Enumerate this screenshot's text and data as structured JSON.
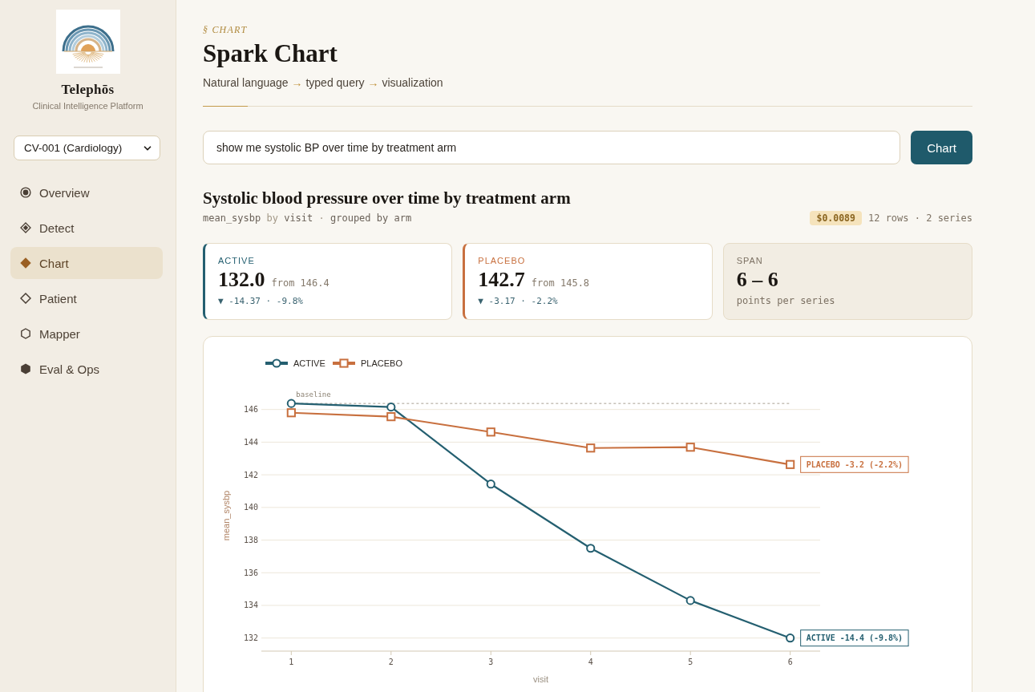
{
  "sidebar": {
    "brand": {
      "name": "Telephōs",
      "tagline": "Clinical Intelligence Platform"
    },
    "study_select": {
      "value": "CV-001 (Cardiology)"
    },
    "nav": [
      {
        "label": "Overview",
        "selected": false
      },
      {
        "label": "Detect",
        "selected": false
      },
      {
        "label": "Chart",
        "selected": true
      },
      {
        "label": "Patient",
        "selected": false
      },
      {
        "label": "Mapper",
        "selected": false
      },
      {
        "label": "Eval & Ops",
        "selected": false
      }
    ]
  },
  "header": {
    "eyebrow": "§ CHART",
    "title": "Spark Chart",
    "subtitle": [
      {
        "kind": "text",
        "text": "Natural language"
      },
      {
        "kind": "arrow",
        "text": "→"
      },
      {
        "kind": "text",
        "text": "typed query"
      },
      {
        "kind": "arrow",
        "text": "→"
      },
      {
        "kind": "text",
        "text": "visualization"
      }
    ]
  },
  "query": {
    "value": "show me systolic BP over time by treatment arm",
    "button": "Chart"
  },
  "result": {
    "title": "Systolic blood pressure over time by treatment arm",
    "query_summary": [
      {
        "kind": "field",
        "text": "mean_sysbp"
      },
      {
        "kind": "keyword",
        "text": "by"
      },
      {
        "kind": "field",
        "text": "visit"
      },
      {
        "kind": "keyword",
        "text": "·"
      },
      {
        "kind": "field",
        "text": "grouped by arm"
      }
    ],
    "cost": "$0.0089",
    "stats": "12 rows · 2 series",
    "cards": [
      {
        "kind": "series",
        "label": "ACTIVE",
        "color": "#245f70",
        "value": "132.0",
        "from": "from 146.4",
        "delta": "▼ -14.37 · -9.8%"
      },
      {
        "kind": "series",
        "label": "PLACEBO",
        "color": "#c8703f",
        "value": "142.7",
        "from": "from 145.8",
        "delta": "▼ -3.17 · -2.2%"
      },
      {
        "kind": "summary",
        "label": "SPAN",
        "value": "6 – 6",
        "caption": "points per series"
      }
    ],
    "chart_data": {
      "type": "line",
      "xlabel": "visit",
      "ylabel": "mean_sysbp",
      "x": [
        1,
        2,
        3,
        4,
        5,
        6
      ],
      "series": [
        {
          "name": "ACTIVE",
          "color": "#245f70",
          "marker": "circle",
          "values": [
            146.37,
            146.15,
            141.43,
            137.5,
            134.3,
            132.0
          ]
        },
        {
          "name": "PLACEBO",
          "color": "#c8703f",
          "marker": "square",
          "values": [
            145.8,
            145.56,
            144.62,
            143.64,
            143.69,
            142.63
          ]
        }
      ],
      "xlim": [
        0.7,
        6.3
      ],
      "ylim": [
        131.2,
        146.5
      ],
      "xticks": [
        1,
        2,
        3,
        4,
        5,
        6
      ],
      "yticks": [
        132,
        134,
        136,
        138,
        140,
        142,
        144,
        146
      ],
      "grid": true,
      "legend": "top-left",
      "ref_lines": [
        {
          "axis": "y",
          "value": 146.37,
          "label": "baseline"
        }
      ],
      "annotations": [
        {
          "text": "PLACEBO -3.2 (-2.2%)",
          "x": 6,
          "y": 142.63
        },
        {
          "text": "ACTIVE -14.4 (-9.8%)",
          "x": 6,
          "y": 132.0
        }
      ]
    }
  }
}
